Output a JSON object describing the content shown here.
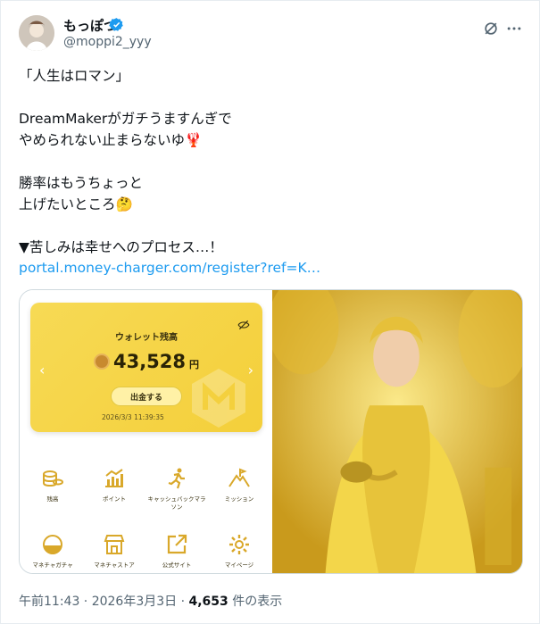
{
  "user": {
    "display_name": "もっぽつ",
    "handle": "@moppi2_yyy",
    "verified_icon": "verified-badge-icon",
    "accent": "#1d9bf0"
  },
  "header_icons": [
    "grok-icon",
    "more-icon"
  ],
  "tweet": {
    "text": "「人生はロマン」\n\nDreamMakerがガチうますんぎで\nやめられない止まらないゆ🦞\n\n勝率はもうちょっと\n上げたいところ🤔\n\n▼苦しみは幸せへのプロセス…！",
    "link": "portal.money-charger.com/register?ref=K…"
  },
  "media": {
    "wallet": {
      "title": "ウォレット残高",
      "amount": "43,528",
      "unit": "円",
      "button": "出金する",
      "date": "2026/3/3 11:39:35"
    },
    "grid": [
      {
        "label": "残高",
        "icon": "coins-icon"
      },
      {
        "label": "ポイント",
        "icon": "chart-icon"
      },
      {
        "label": "キャッシュバックマラソン",
        "icon": "runner-icon"
      },
      {
        "label": "ミッション",
        "icon": "mountain-icon"
      },
      {
        "label": "マネチャガチャ",
        "icon": "gacha-icon"
      },
      {
        "label": "マネチャストア",
        "icon": "store-icon"
      },
      {
        "label": "公式サイト",
        "icon": "external-link-icon"
      },
      {
        "label": "マイページ",
        "icon": "gear-icon"
      }
    ],
    "accent": "#f4cf3a"
  },
  "footer": {
    "time": "午前11:43 · 2026年3月3日 · ",
    "views": "4,653",
    "views_suffix": " 件の表示"
  }
}
